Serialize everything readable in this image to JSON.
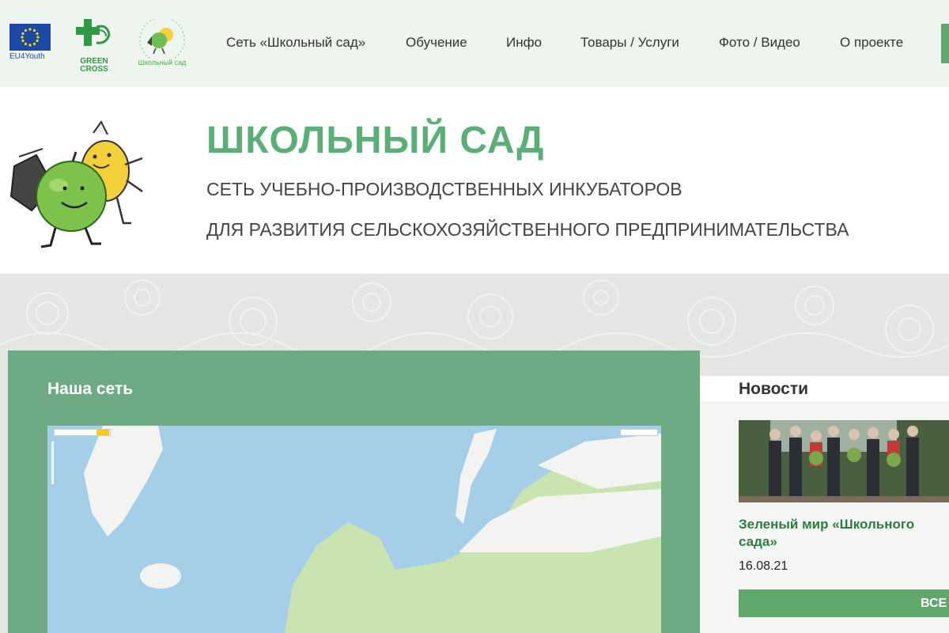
{
  "colors": {
    "accent": "#5cae77",
    "nav_bg": "#eef5ef",
    "panel": "#6eab84",
    "button": "#5fa76a",
    "link": "#2e7a43"
  },
  "logos": {
    "eu": {
      "caption": "EU4Youth"
    },
    "green_cross": {
      "caption_line1": "GREEN",
      "caption_line2": "CROSS"
    },
    "school_garden": {
      "caption": "Школьный сад"
    }
  },
  "nav": {
    "items": [
      "Сеть «Школьный сад»",
      "Обучение",
      "Инфо",
      "Товары / Услуги",
      "Фото / Видео",
      "О проекте"
    ]
  },
  "header": {
    "title": "ШКОЛЬНЫЙ САД",
    "subtitle1": "СЕТЬ УЧЕБНО-ПРОИЗВОДСТВЕННЫХ ИНКУБАТОРОВ",
    "subtitle2": "ДЛЯ РАЗВИТИЯ СЕЛЬСКОХОЗЯЙСТВЕННОГО ПРЕДПРИНИМАТЕЛЬСТВА"
  },
  "network": {
    "title": "Наша сеть"
  },
  "news": {
    "title": "Новости",
    "items": [
      {
        "headline": "Зеленый мир «Школьного сада»",
        "date": "16.08.21"
      }
    ],
    "all_button": "ВСЕ"
  }
}
